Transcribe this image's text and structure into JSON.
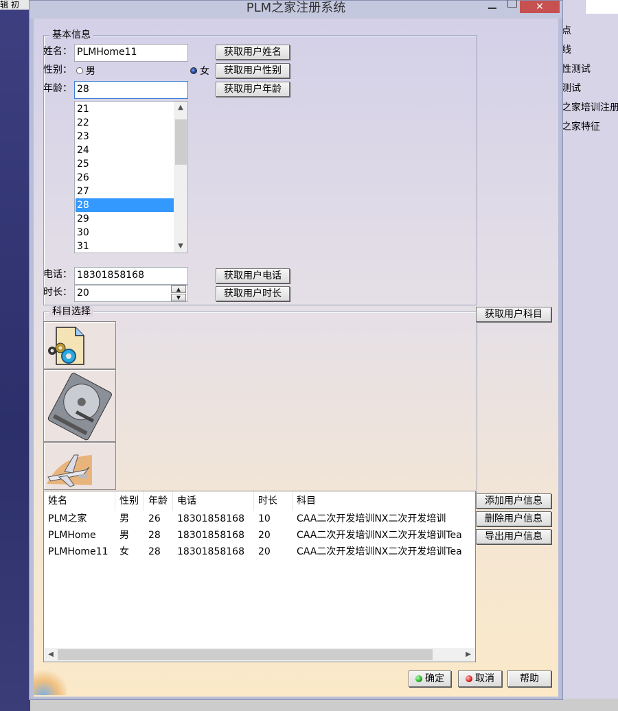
{
  "background": {
    "top_left_text": "辑   初",
    "right_items": [
      "点",
      "线",
      "性测试",
      "测试",
      "之家培训注册",
      "之家特征"
    ]
  },
  "window": {
    "title": "PLM之家注册系统",
    "close_glyph": "✕"
  },
  "basic_info": {
    "legend": "基本信息",
    "name_label": "姓名：",
    "name_value": "PLMHome11",
    "gender_label": "性别：",
    "gender_male": "男",
    "gender_female": "女",
    "gender_selected": "女",
    "age_label": "年龄：",
    "age_value": "28",
    "age_options": [
      "21",
      "22",
      "23",
      "24",
      "25",
      "26",
      "27",
      "28",
      "29",
      "30",
      "31"
    ],
    "age_selected": "28",
    "phone_label": "电话：",
    "phone_value": "18301858168",
    "duration_label": "时长：",
    "duration_value": "20",
    "buttons": {
      "get_name": "获取用户姓名",
      "get_gender": "获取用户性别",
      "get_age": "获取用户年龄",
      "get_phone": "获取用户电话",
      "get_duration": "获取用户时长"
    }
  },
  "subjects": {
    "legend": "科目选择",
    "get_subject": "获取用户科目",
    "items": [
      {
        "icon": "document-gear-icon"
      },
      {
        "icon": "hard-disk-icon"
      },
      {
        "icon": "airplane-icon"
      }
    ]
  },
  "table": {
    "columns": [
      "姓名",
      "性别",
      "年龄",
      "电话",
      "时长",
      "科目"
    ],
    "rows": [
      [
        "PLM之家",
        "男",
        "26",
        "18301858168",
        "10",
        "CAA二次开发培训NX二次开发培训"
      ],
      [
        "PLMHome",
        "男",
        "28",
        "18301858168",
        "20",
        "CAA二次开发培训NX二次开发培训Tea"
      ],
      [
        "PLMHome11",
        "女",
        "28",
        "18301858168",
        "20",
        "CAA二次开发培训NX二次开发培训Tea"
      ]
    ],
    "add_button": "添加用户信息",
    "delete_button": "删除用户信息",
    "export_button": "导出用户信息"
  },
  "footer": {
    "ok": "确定",
    "cancel": "取消",
    "help": "帮助",
    "ok_color": "#1faa1f",
    "cancel_color": "#d42020"
  }
}
